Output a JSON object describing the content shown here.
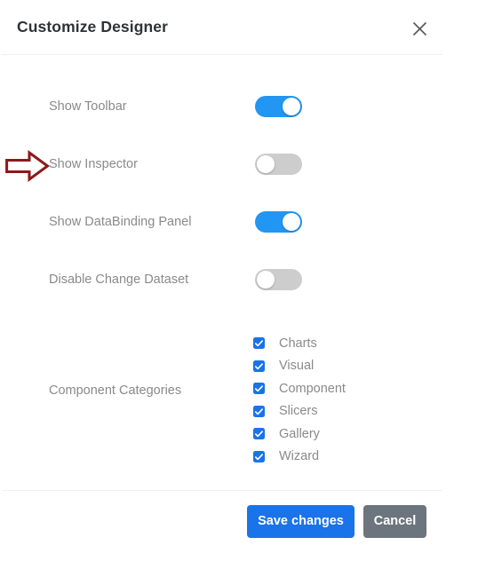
{
  "dialog": {
    "title": "Customize Designer",
    "close_icon": "close-x-icon"
  },
  "settings": [
    {
      "label": "Show Toolbar",
      "state": "on",
      "state_label": "On"
    },
    {
      "label": "Show Inspector",
      "state": "off",
      "state_label": "Off"
    },
    {
      "label": "Show DataBinding Panel",
      "state": "on",
      "state_label": "On"
    },
    {
      "label": "Disable Change Dataset",
      "state": "off",
      "state_label": "Off"
    }
  ],
  "categories": {
    "label": "Component Categories",
    "items": [
      {
        "label": "Charts",
        "checked": true
      },
      {
        "label": "Visual",
        "checked": true
      },
      {
        "label": "Component",
        "checked": true
      },
      {
        "label": "Slicers",
        "checked": true
      },
      {
        "label": "Gallery",
        "checked": true
      },
      {
        "label": "Wizard",
        "checked": true
      }
    ]
  },
  "footer": {
    "save_label": "Save changes",
    "cancel_label": "Cancel"
  },
  "annotation": {
    "target": "Show Inspector",
    "icon": "right-arrow-annotation",
    "color": "#8b1a1a"
  },
  "colors": {
    "accent_blue": "#1a73e8",
    "toggle_on": "#2196f3",
    "toggle_off": "#cdcdcd",
    "cancel_gray": "#6c757d",
    "label_gray": "#8a8a8a",
    "title_dark": "#2e3338",
    "divider": "#edeff2",
    "annotation_red": "#8b1a1a"
  }
}
